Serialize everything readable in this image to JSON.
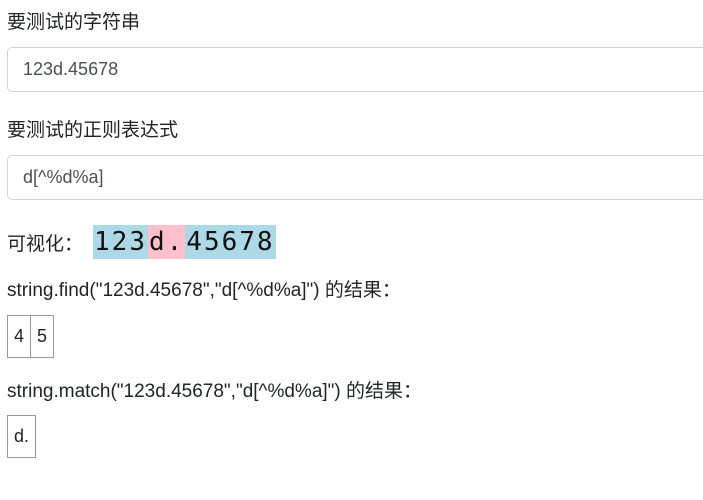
{
  "test_string": {
    "label": "要测试的字符串",
    "value": "123d.45678"
  },
  "regex": {
    "label": "要测试的正则表达式",
    "value": "d[^%d%a]"
  },
  "visualization": {
    "label": "可视化：",
    "segments": [
      {
        "text": "123",
        "matched": false
      },
      {
        "text": "d.",
        "matched": true
      },
      {
        "text": "45678",
        "matched": false
      }
    ],
    "colors": {
      "unmatched": "#add8e6",
      "matched": "#ffc0cb"
    }
  },
  "find_result": {
    "label": "string.find(\"123d.45678\",\"d[^%d%a]\") 的结果：",
    "cells": [
      "4",
      "5"
    ]
  },
  "match_result": {
    "label": "string.match(\"123d.45678\",\"d[^%d%a]\") 的结果：",
    "cells": [
      "d."
    ]
  }
}
